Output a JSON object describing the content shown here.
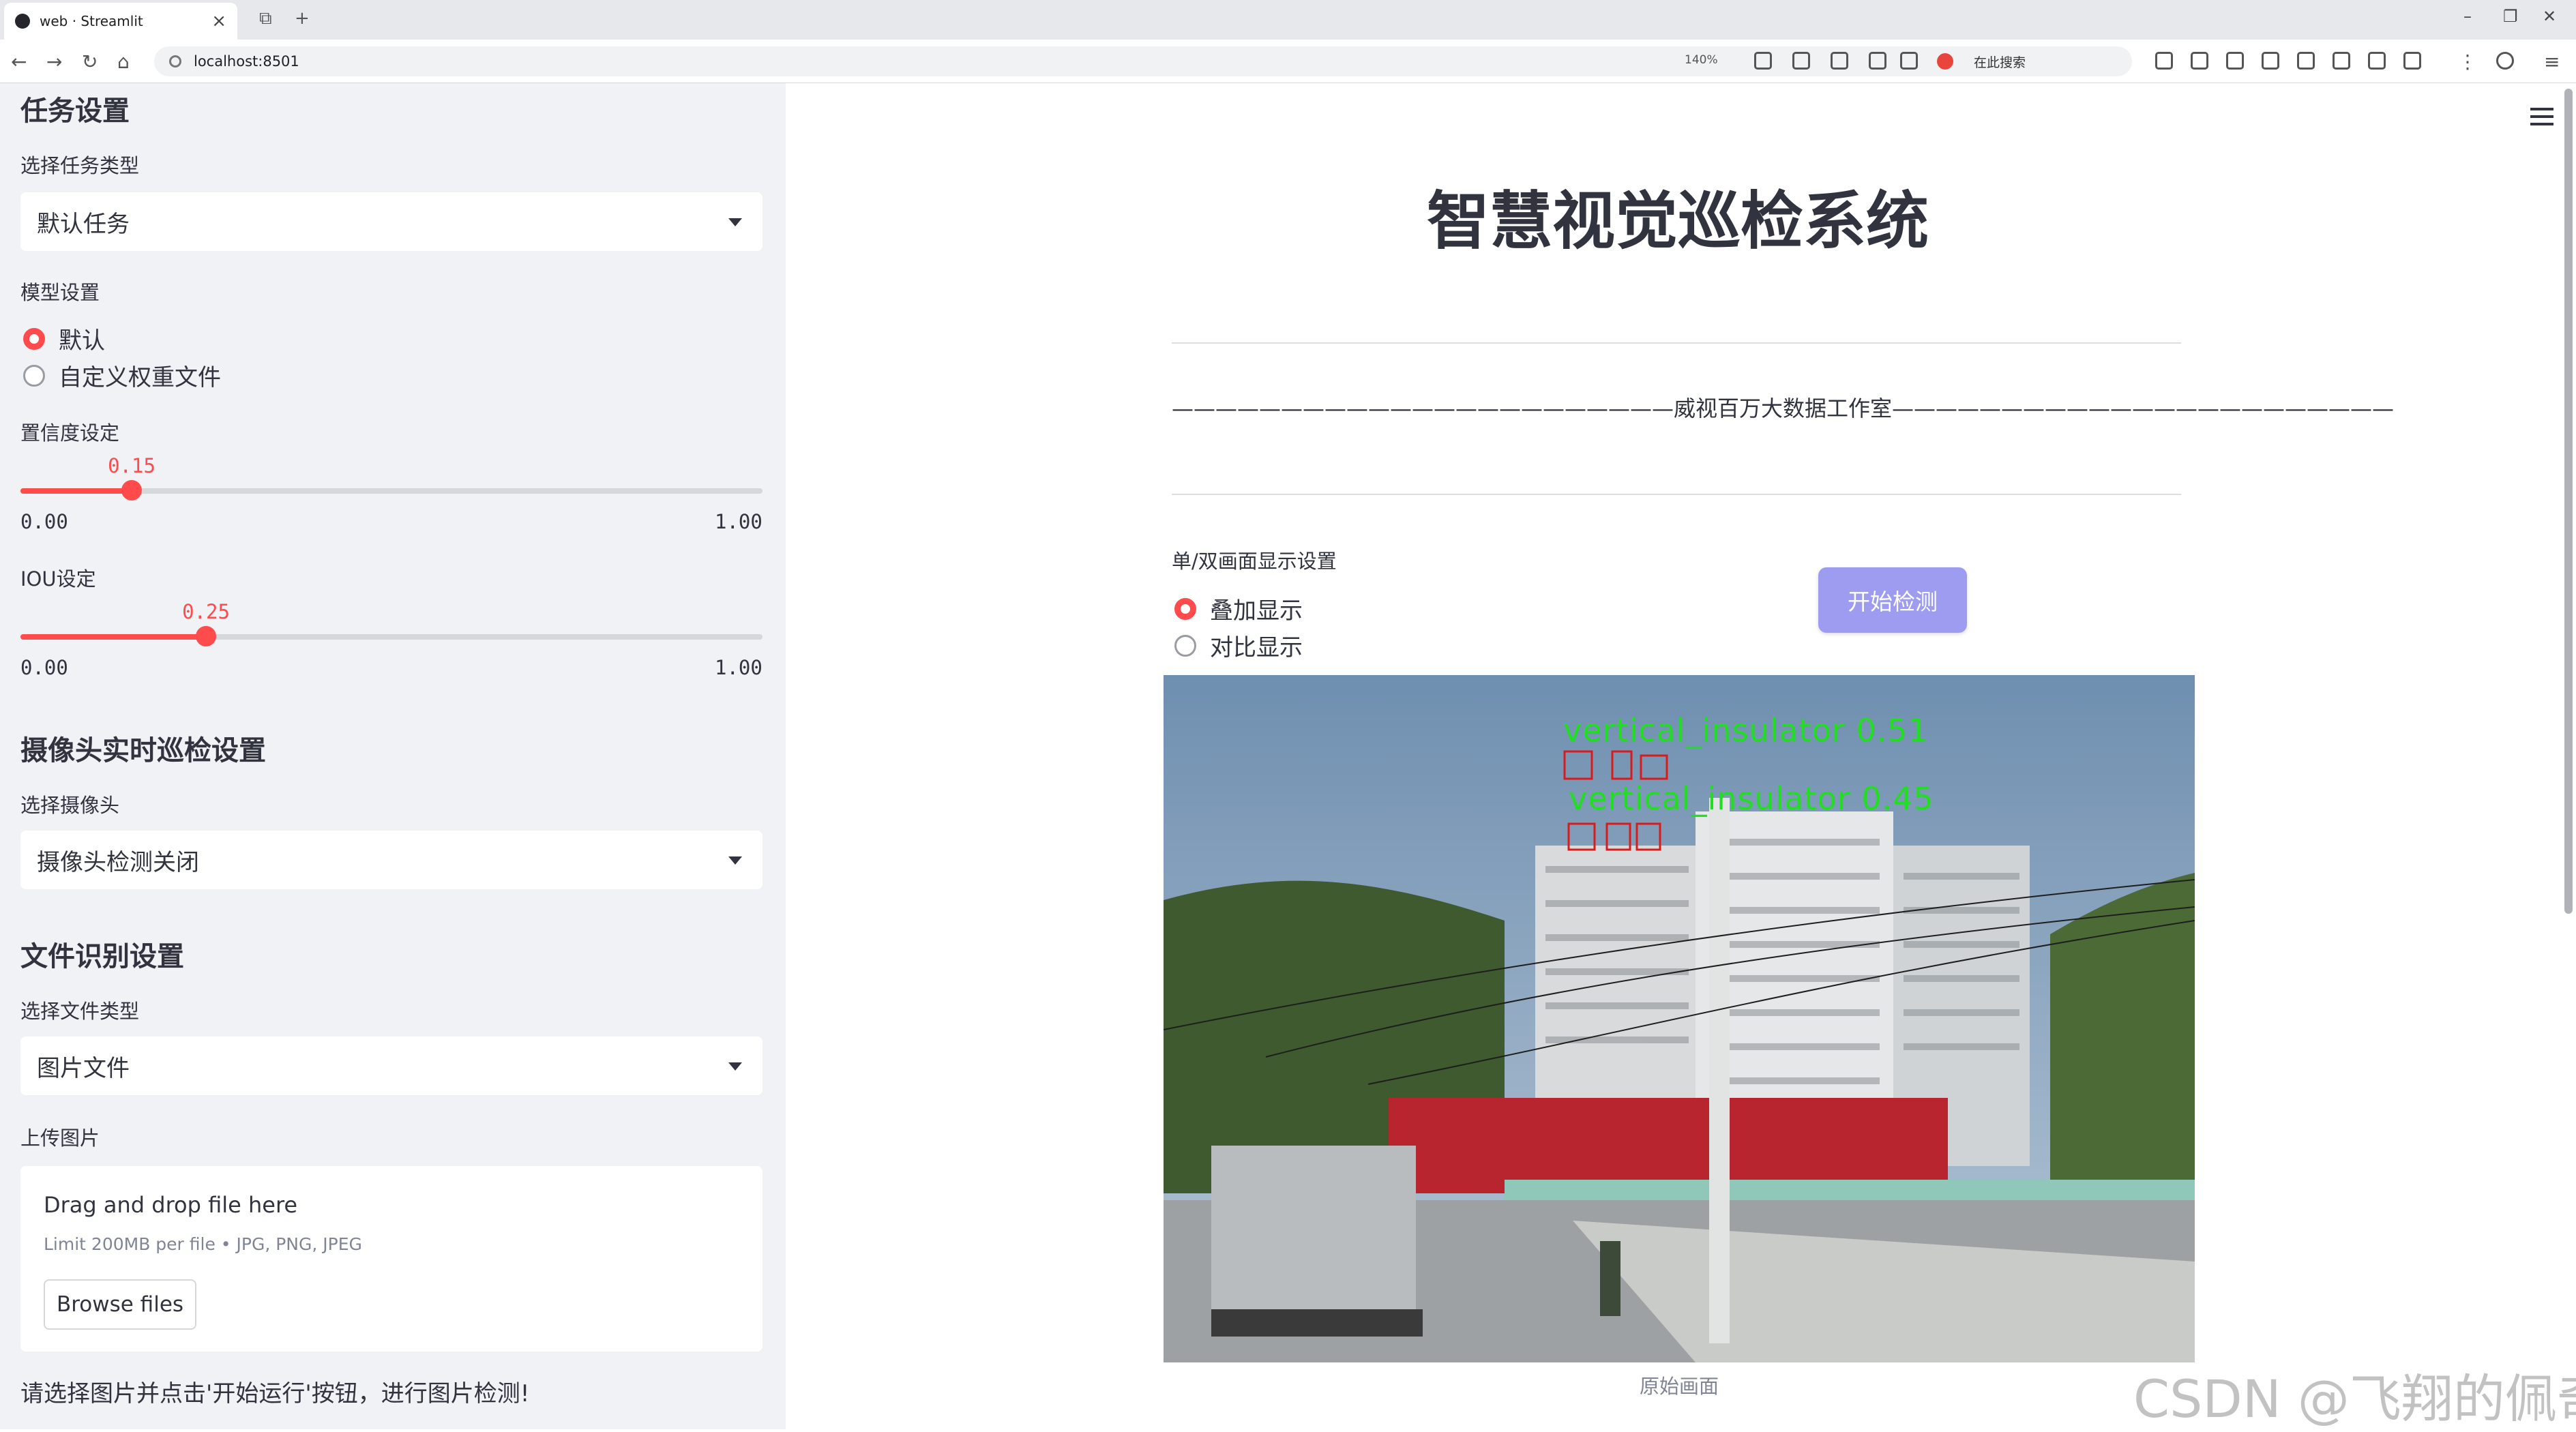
{
  "browser": {
    "tab_title": "web · Streamlit",
    "url": "localhost:8501",
    "zoom": "140%",
    "search_placeholder": "在此搜索"
  },
  "sidebar": {
    "task_section_title": "任务设置",
    "task_type_label": "选择任务类型",
    "task_type_value": "默认任务",
    "model_label": "模型设置",
    "model_options": [
      "默认",
      "自定义权重文件"
    ],
    "model_selected": "默认",
    "confidence": {
      "label": "置信度设定",
      "value": "0.15",
      "min": "0.00",
      "max": "1.00",
      "fraction": 0.15
    },
    "iou": {
      "label": "IOU设定",
      "value": "0.25",
      "min": "0.00",
      "max": "1.00",
      "fraction": 0.25
    },
    "camera_section_title": "摄像头实时巡检设置",
    "camera_label": "选择摄像头",
    "camera_value": "摄像头检测关闭",
    "file_section_title": "文件识别设置",
    "file_type_label": "选择文件类型",
    "file_type_value": "图片文件",
    "upload_label": "上传图片",
    "upload_title": "Drag and drop file here",
    "upload_limit": "Limit 200MB per file • JPG, PNG, JPEG",
    "browse_label": "Browse files",
    "note": "请选择图片并点击'开始运行'按钮，进行图片检测!"
  },
  "main": {
    "title": "智慧视觉巡检系统",
    "subtitle": "———————————————————————威视百万大数据工作室———————————————————————",
    "display_mode_label": "单/双画面显示设置",
    "display_options": [
      "叠加显示",
      "对比显示"
    ],
    "display_selected": "叠加显示",
    "start_button": "开始检测",
    "image_caption": "原始画面",
    "detection_text_1": "vertical_insulator 0.51",
    "detection_text_2": "vertical_insulator 0.45"
  },
  "watermark": "CSDN @飞翔的佩奇",
  "colors": {
    "accent": "#ff4b4b",
    "sidebar_bg": "#f0f2f6",
    "button": "#9e9cf0",
    "detection": "#22dd22"
  }
}
